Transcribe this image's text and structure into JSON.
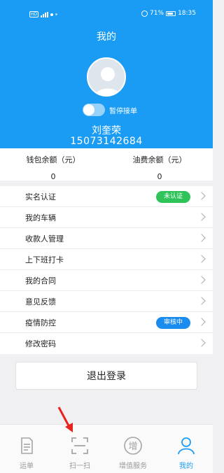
{
  "status_bar": {
    "left_text": "HD",
    "battery": "71%",
    "time": "18:35"
  },
  "header": {
    "title": "我的",
    "toggle_label": "暂停接单",
    "username": "刘奎荣",
    "phone": "15073142684"
  },
  "balance": {
    "wallet_label": "钱包余额（元）",
    "wallet_value": "0",
    "fuel_label": "油费余额（元）",
    "fuel_value": "0"
  },
  "menu": {
    "items": [
      {
        "label": "实名认证",
        "badge": "未认证",
        "badge_color": "#2fc35a"
      },
      {
        "label": "我的车辆"
      },
      {
        "label": "收款人管理"
      },
      {
        "label": "上下班打卡"
      },
      {
        "label": "我的合同"
      },
      {
        "label": "意见反馈"
      },
      {
        "label": "疫情防控",
        "badge": "审核中",
        "badge_color": "#1a8cf0"
      },
      {
        "label": "修改密码"
      }
    ]
  },
  "logout_label": "退出登录",
  "tabs": [
    {
      "label": "运单",
      "icon": "waybill-icon"
    },
    {
      "label": "扫一扫",
      "icon": "scan-icon"
    },
    {
      "label": "增值服务",
      "icon": "value-added-icon",
      "icon_char": "增"
    },
    {
      "label": "我的",
      "icon": "person-icon",
      "active": true
    }
  ],
  "colors": {
    "primary": "#1a9cf5",
    "verified_badge": "#2fc35a",
    "review_badge": "#1a8cf0",
    "annotation_arrow": "#e8231f"
  }
}
